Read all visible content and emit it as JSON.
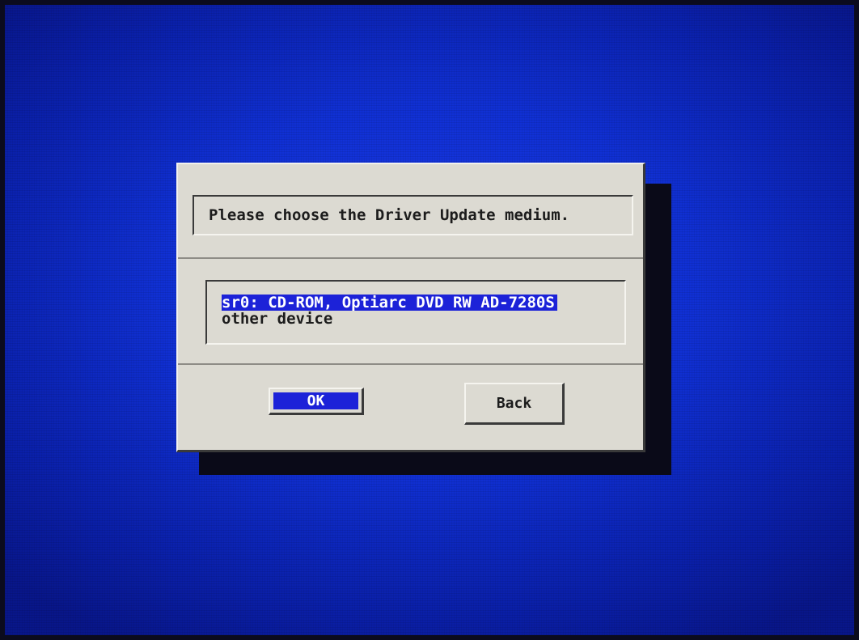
{
  "dialog": {
    "title": "Please choose the Driver Update medium.",
    "items": [
      {
        "label": "sr0: CD-ROM, Optiarc DVD RW AD-7280S",
        "selected": true
      },
      {
        "label": "other device",
        "selected": false
      }
    ],
    "ok_label": "OK",
    "back_label": "Back"
  },
  "colors": {
    "background": "#1030d4",
    "dialog": "#dcdad2",
    "highlight": "#1c22d8"
  }
}
